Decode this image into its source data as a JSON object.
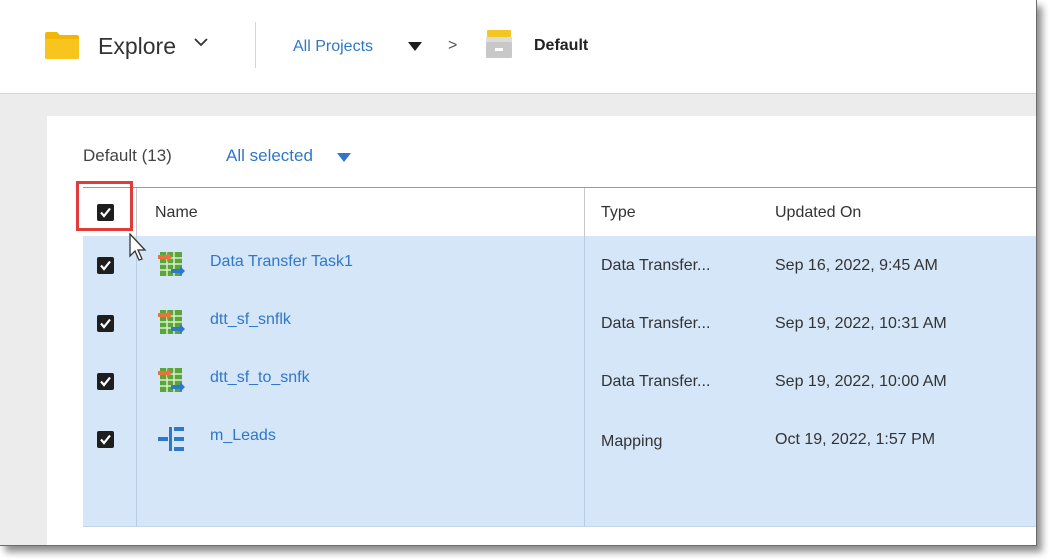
{
  "topbar": {
    "explore_label": "Explore",
    "breadcrumb_all_projects": "All Projects",
    "breadcrumb_separator": ">",
    "breadcrumb_current": "Default"
  },
  "list": {
    "title": "Default (13)",
    "selection_label": "All selected",
    "columns": [
      "Name",
      "Type",
      "Updated On"
    ],
    "rows": [
      {
        "name": "Data Transfer Task1",
        "type": "Data Transfer...",
        "updated": "Sep 16, 2022, 9:45 AM",
        "icon": "data-transfer-task-icon",
        "checked": true
      },
      {
        "name": "dtt_sf_snflk",
        "type": "Data Transfer...",
        "updated": "Sep 19, 2022, 10:31 AM",
        "icon": "data-transfer-task-icon",
        "checked": true
      },
      {
        "name": "dtt_sf_to_snfk",
        "type": "Data Transfer...",
        "updated": "Sep 19, 2022, 10:00 AM",
        "icon": "data-transfer-task-icon",
        "checked": true
      },
      {
        "name": "m_Leads",
        "type": "Mapping",
        "updated": "Oct 19, 2022, 1:57 PM",
        "icon": "mapping-icon",
        "checked": true
      }
    ]
  },
  "colors": {
    "link": "#2f77c8",
    "selected_row": "#d4e6f8",
    "highlight": "#e03c3c",
    "folder": "#f5c518"
  }
}
